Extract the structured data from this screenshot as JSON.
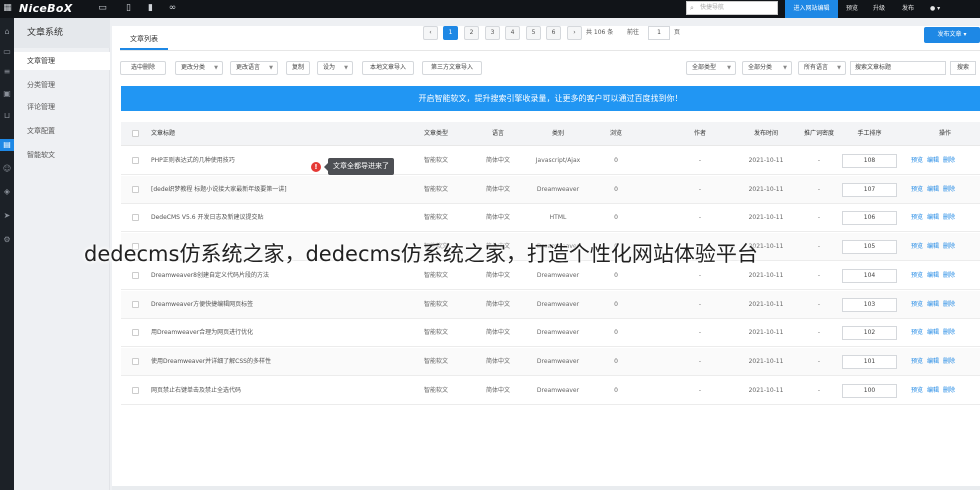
{
  "topbar": {
    "brand": "NiceBoX",
    "search_placeholder": "快捷导航",
    "enter_label": "进入网站编辑",
    "links": [
      "预览",
      "升级",
      "发布"
    ],
    "user": "●  ▾"
  },
  "subnav": {
    "title": "文章系统",
    "items": [
      "文章管理",
      "分类管理",
      "评论管理",
      "文章配置",
      "智能软文"
    ],
    "active_index": 0
  },
  "tab": {
    "label": "文章列表",
    "publish": "发布文章 ▾"
  },
  "toolbar": {
    "buttons": [
      "选中删除",
      "更改分类",
      "更改语言",
      "复制",
      "设为",
      "本地文章导入",
      "第三方文章导入"
    ],
    "filters": [
      "全部类型",
      "全部分类",
      "所有语言"
    ],
    "search_placeholder": "搜索文章标题",
    "search_btn": "搜索"
  },
  "banner": "开启智能软文，提升搜索引擎收录量，让更多的客户可以通过百度找到你！",
  "columns": [
    "文章标题",
    "文章类型",
    "语言",
    "类别",
    "浏览",
    "作者",
    "发布时间",
    "推广词密度",
    "手工排序",
    "操作"
  ],
  "rows": [
    {
      "title": "PHP正则表达式的几种使用技巧",
      "type": "智能软文",
      "lang": "简体中文",
      "cat": "Javascript/Ajax",
      "views": "0",
      "author": "-",
      "date": "2021-10-11",
      "density": "-",
      "sort": "108"
    },
    {
      "title": "[dede织梦教程 标题小说接大家最新年级要第一讲]",
      "type": "智能软文",
      "lang": "简体中文",
      "cat": "Dreamweaver",
      "views": "0",
      "author": "-",
      "date": "2021-10-11",
      "density": "-",
      "sort": "107"
    },
    {
      "title": "DedeCMS V5.6 开发日志及新建议提交贴",
      "type": "智能软文",
      "lang": "简体中文",
      "cat": "HTML",
      "views": "0",
      "author": "-",
      "date": "2021-10-11",
      "density": "-",
      "sort": "106"
    },
    {
      "title": "",
      "type": "智能软文",
      "lang": "简体中文",
      "cat": "Dreamweaver",
      "views": "0",
      "author": "-",
      "date": "2021-10-11",
      "density": "-",
      "sort": "105"
    },
    {
      "title": "Dreamweaver8创建自定义代码片段的方法",
      "type": "智能软文",
      "lang": "简体中文",
      "cat": "Dreamweaver",
      "views": "0",
      "author": "-",
      "date": "2021-10-11",
      "density": "-",
      "sort": "104"
    },
    {
      "title": "Dreamweaver方便快捷编辑网页标签",
      "type": "智能软文",
      "lang": "简体中文",
      "cat": "Dreamweaver",
      "views": "0",
      "author": "-",
      "date": "2021-10-11",
      "density": "-",
      "sort": "103"
    },
    {
      "title": "用Dreamweaver合理为网页进行优化",
      "type": "智能软文",
      "lang": "简体中文",
      "cat": "Dreamweaver",
      "views": "0",
      "author": "-",
      "date": "2021-10-11",
      "density": "-",
      "sort": "102"
    },
    {
      "title": "使用Dreamweaver并详细了解CSS的多样性",
      "type": "智能软文",
      "lang": "简体中文",
      "cat": "Dreamweaver",
      "views": "0",
      "author": "-",
      "date": "2021-10-11",
      "density": "-",
      "sort": "101"
    },
    {
      "title": "网页禁止右键单击及禁止全选代码",
      "type": "智能软文",
      "lang": "简体中文",
      "cat": "Dreamweaver",
      "views": "0",
      "author": "-",
      "date": "2021-10-11",
      "density": "-",
      "sort": "100"
    }
  ],
  "ops": [
    "预览",
    "编辑",
    "删除"
  ],
  "tooltip": {
    "badge": "!",
    "text": "文章全都导进来了"
  },
  "pager": {
    "prev": "‹",
    "pages": [
      "1",
      "2",
      "3",
      "4",
      "5",
      "6"
    ],
    "active": "1",
    "next": "›",
    "total": "共 106 条",
    "goto_label": "前往",
    "goto_value": "1",
    "page_unit": "页"
  },
  "watermark": "dedecms仿系统之家，dedecms仿系统之家，打造个性化网站体验平台"
}
